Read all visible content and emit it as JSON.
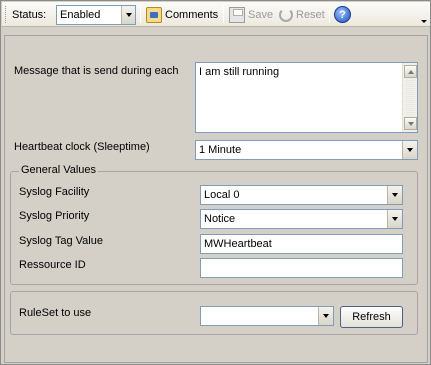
{
  "toolbar": {
    "status_label": "Status:",
    "status_value": "Enabled",
    "comments_label": "Comments",
    "save_label": "Save",
    "reset_label": "Reset",
    "help_glyph": "?"
  },
  "form": {
    "message_label": "Message that is send during each",
    "message_value": "I am still running",
    "heartbeat_label": "Heartbeat clock (Sleeptime)",
    "heartbeat_value": "1 Minute",
    "group_title": "General Values",
    "facility_label": "Syslog Facility",
    "facility_value": "Local 0",
    "priority_label": "Syslog Priority",
    "priority_value": "Notice",
    "tag_label": "Syslog Tag Value",
    "tag_value": "MWHeartbeat",
    "resource_label": "Ressource ID",
    "resource_value": "",
    "ruleset_label": "RuleSet to use",
    "ruleset_value": "",
    "refresh_label": "Refresh"
  },
  "colors": {
    "panel_bg": "#d4d0c8",
    "input_border": "#7f9db9",
    "disabled_text": "#9a9a9a"
  },
  "icons": [
    "comments-icon",
    "save-icon",
    "reset-icon",
    "help-icon",
    "chevron-down-icon"
  ]
}
